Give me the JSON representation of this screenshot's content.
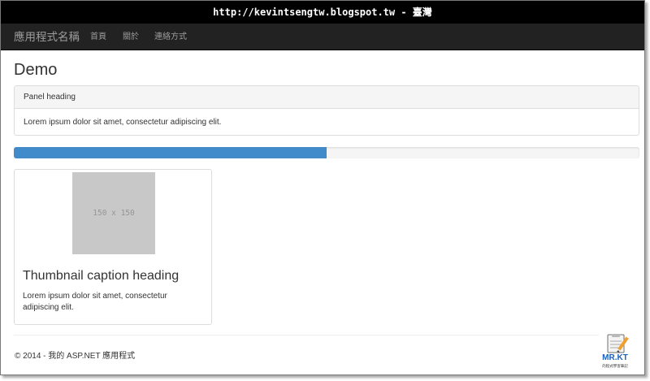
{
  "watermark": {
    "url_text": "http://kevintsengtw.blogspot.tw - 臺灣"
  },
  "navbar": {
    "brand": "應用程式名稱",
    "links": [
      "首頁",
      "關於",
      "連絡方式"
    ]
  },
  "main": {
    "title": "Demo",
    "panel": {
      "heading": "Panel heading",
      "body": "Lorem ipsum dolor sit amet, consectetur adipiscing elit."
    },
    "progress": {
      "value_percent": 50
    },
    "thumbnail": {
      "image_placeholder": "150 x 150",
      "caption_heading": "Thumbnail caption heading",
      "caption_text": "Lorem ipsum dolor sit amet, consectetur adipiscing elit."
    }
  },
  "footer": {
    "text": "© 2014 - 我的 ASP.NET 應用程式"
  },
  "logo": {
    "name": "MR.KT",
    "tagline": "的程式學習筆記"
  },
  "colors": {
    "navbar_bg": "#222222",
    "navbar_text": "#9d9d9d",
    "progress_fill": "#428bca",
    "progress_track": "#f5f5f5",
    "panel_heading_bg": "#f5f5f5",
    "border": "#dddddd",
    "placeholder_bg": "#c8c8c8"
  },
  "icons": {
    "logo": "clipboard-pencil-logo-icon"
  }
}
